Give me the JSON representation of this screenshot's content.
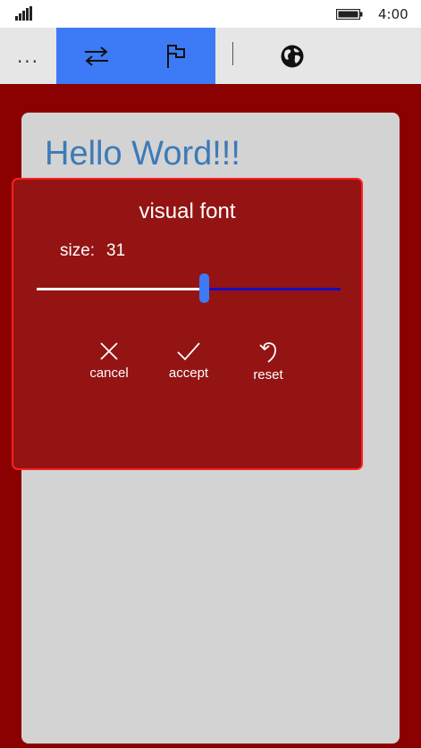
{
  "status": {
    "time": "4:00"
  },
  "appbar": {
    "more_label": "..."
  },
  "content": {
    "heading": "Hello Word!!!"
  },
  "dialog": {
    "title": "visual font",
    "size_label": "size:",
    "size_value": "31",
    "slider": {
      "value": 31,
      "min": 0,
      "max": 56
    },
    "actions": {
      "cancel": "cancel",
      "accept": "accept",
      "reset": "reset"
    }
  },
  "colors": {
    "page_background": "#8b0000",
    "accent": "#3d7af5",
    "dialog_background": "#941414",
    "dialog_border": "#ff1f1f",
    "heading_text": "#3d7ab8",
    "slider_track_filled": "#ffffff",
    "slider_track_empty": "#1a0bbf"
  }
}
